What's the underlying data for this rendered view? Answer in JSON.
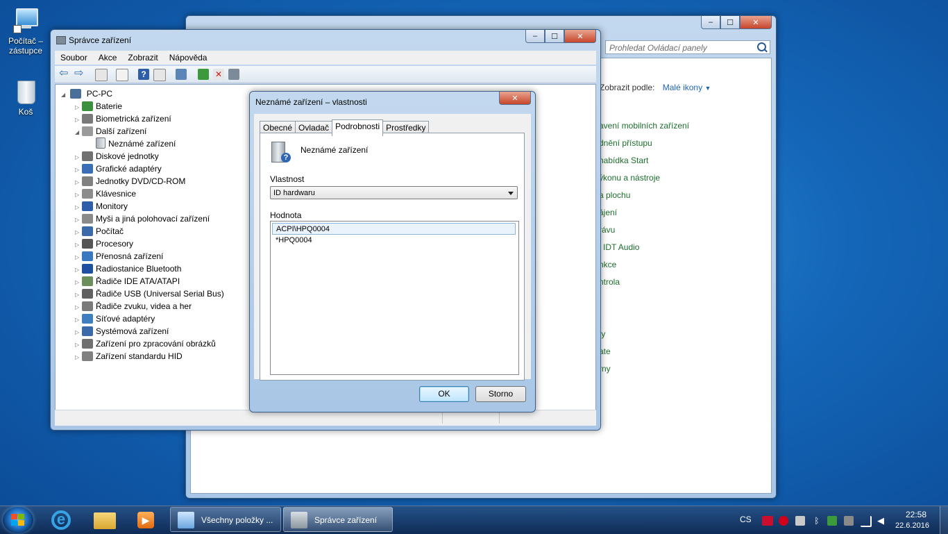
{
  "desktop": {
    "icons": [
      {
        "label_line1": "Počítač –",
        "label_line2": "zástupce"
      },
      {
        "label_line1": "Koš",
        "label_line2": ""
      }
    ]
  },
  "control_panel": {
    "search_placeholder": "Prohledat Ovládací panely",
    "view_by_label": "Zobrazit podle:",
    "view_by_value": "Malé ikony",
    "links": [
      "avení mobilních zařízení",
      "dnění přístupu",
      "nabídka Start",
      "ýkonu a nástroje",
      "a plochu",
      "ájení",
      "rávu",
      "l IDT Audio",
      "nkce",
      "ntrola",
      "ty",
      "ate",
      "rny"
    ]
  },
  "device_manager": {
    "title": "Správce zařízení",
    "menu": [
      "Soubor",
      "Akce",
      "Zobrazit",
      "Nápověda"
    ],
    "root": "PC-PC",
    "nodes": [
      {
        "label": "Baterie",
        "expander": "closed",
        "icon_color": "#3c8f3c"
      },
      {
        "label": "Biometrická zařízení",
        "expander": "closed",
        "icon_color": "#7a7a7a"
      },
      {
        "label": "Další zařízení",
        "expander": "open",
        "icon_color": "#9a9a9a"
      },
      {
        "label": "Neznámé zařízení",
        "expander": "none",
        "icon_color": "#d9a400",
        "child": true
      },
      {
        "label": "Diskové jednotky",
        "expander": "closed",
        "icon_color": "#707070"
      },
      {
        "label": "Grafické adaptéry",
        "expander": "closed",
        "icon_color": "#3b6fb5"
      },
      {
        "label": "Jednotky DVD/CD-ROM",
        "expander": "closed",
        "icon_color": "#808080"
      },
      {
        "label": "Klávesnice",
        "expander": "closed",
        "icon_color": "#8c8c8c"
      },
      {
        "label": "Monitory",
        "expander": "closed",
        "icon_color": "#2f5ea8"
      },
      {
        "label": "Myši a jiná polohovací zařízení",
        "expander": "closed",
        "icon_color": "#8a8a8a"
      },
      {
        "label": "Počítač",
        "expander": "closed",
        "icon_color": "#3a6aa8"
      },
      {
        "label": "Procesory",
        "expander": "closed",
        "icon_color": "#555555"
      },
      {
        "label": "Přenosná zařízení",
        "expander": "closed",
        "icon_color": "#3a78c0"
      },
      {
        "label": "Radiostanice Bluetooth",
        "expander": "closed",
        "icon_color": "#1e4fa0"
      },
      {
        "label": "Řadiče IDE ATA/ATAPI",
        "expander": "closed",
        "icon_color": "#6b8e5a"
      },
      {
        "label": "Řadiče USB (Universal Serial Bus)",
        "expander": "closed",
        "icon_color": "#606060"
      },
      {
        "label": "Řadiče zvuku, videa a her",
        "expander": "closed",
        "icon_color": "#7a7a7a"
      },
      {
        "label": "Síťové adaptéry",
        "expander": "closed",
        "icon_color": "#3f7fc0"
      },
      {
        "label": "Systémová zařízení",
        "expander": "closed",
        "icon_color": "#3a6aa8"
      },
      {
        "label": "Zařízení pro zpracování obrázků",
        "expander": "closed",
        "icon_color": "#707070"
      },
      {
        "label": "Zařízení standardu HID",
        "expander": "closed",
        "icon_color": "#808080"
      }
    ]
  },
  "dialog": {
    "title": "Neznámé zařízení – vlastnosti",
    "tabs": [
      "Obecné",
      "Ovladač",
      "Podrobnosti",
      "Prostředky"
    ],
    "active_tab": "Podrobnosti",
    "device_name": "Neznámé zařízení",
    "property_label": "Vlastnost",
    "property_value": "ID hardwaru",
    "value_label": "Hodnota",
    "values": [
      "ACPI\\HPQ0004",
      "*HPQ0004"
    ],
    "ok_label": "OK",
    "cancel_label": "Storno"
  },
  "taskbar": {
    "tasks": [
      "Všechny položky ...",
      "Správce zařízení"
    ],
    "lang": "CS",
    "time": "22:58",
    "date": "22.6.2016"
  },
  "colors": {
    "accent": "#1e64b4",
    "link_green": "#1c6e2c"
  }
}
